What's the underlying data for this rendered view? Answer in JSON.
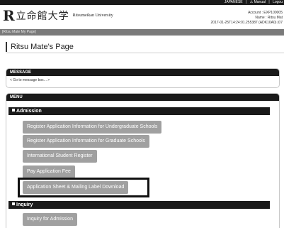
{
  "topbar": {
    "links": [
      "JAPANESE",
      "|",
      "⚠ Manual",
      "|",
      "Logou"
    ]
  },
  "header": {
    "logo_r": "R",
    "logo_jp": "立命館大学",
    "logo_en": "Ritsumeikan University",
    "account_line": "Account : EXP100005",
    "name_line": "Name : Ritsu Mat",
    "timestamp_line": "2017-01-25T14:24:01.255387 (ADK10A0) (07"
  },
  "breadcrumb": "[Ritsu Mate My Page]",
  "page_title": "Ritsu Mate's Page",
  "message": {
    "heading": "MESSAGE",
    "link": "< Go to message box... >"
  },
  "menu": {
    "heading": "MENU",
    "admission": {
      "heading": "Admission",
      "buttons": [
        "Register Application Information for Undergraduate Schools",
        "Register Application Information for Graduate Schools",
        "International Student Register",
        "Pay Application Fee",
        "Application Sheet & Mailing Label Download"
      ]
    },
    "inquiry": {
      "heading": "Inquiry",
      "buttons": [
        "Inquiry for Admission"
      ]
    }
  }
}
